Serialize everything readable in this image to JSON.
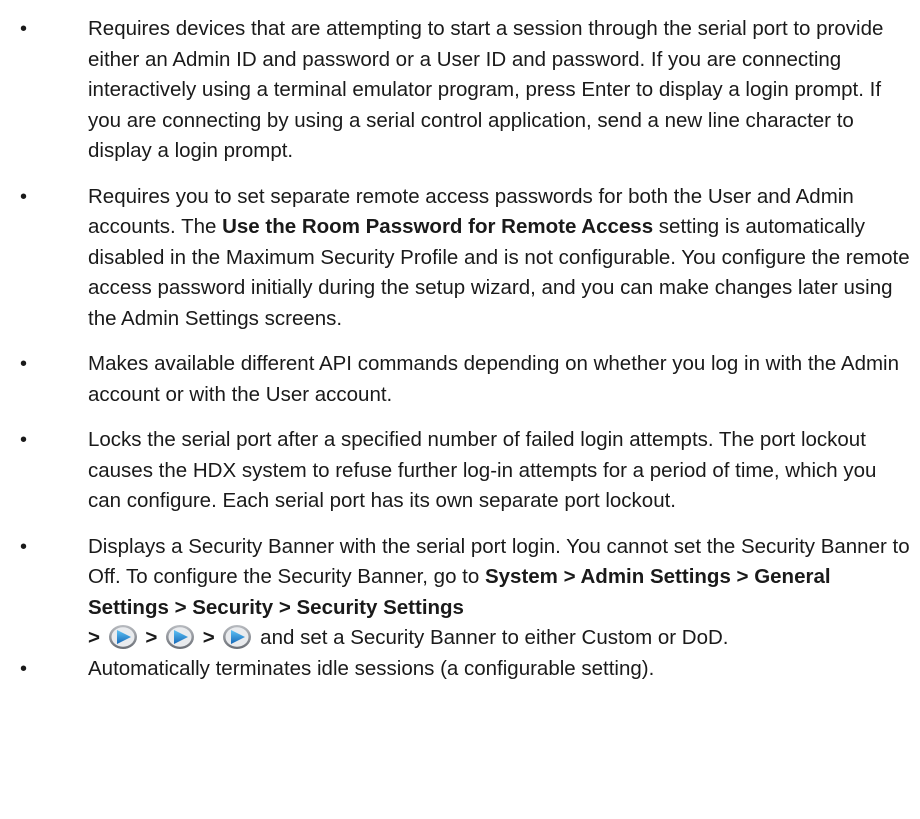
{
  "bullets": [
    {
      "text": "Requires devices that are attempting to start a session through the serial port to provide either an Admin ID and password or a User ID and password. If you are connecting interactively using a terminal emulator program, press Enter to display a login prompt. If you are connecting by using a serial control application, send a new line character to display a login prompt."
    },
    {
      "before": "Requires you to set separate remote access passwords for both the User and Admin accounts. The ",
      "bold": "Use the Room Password for Remote Access",
      "after": " setting is automatically disabled in the Maximum Security Profile and is not configurable. You configure the remote access password initially during the setup wizard, and you can make changes later using the Admin Settings screens."
    },
    {
      "text": "Makes available different API commands depending on whether you log in with the Admin account or with the User account."
    },
    {
      "text": "Locks the serial port after a specified number of failed login attempts. The port lockout causes the HDX system to refuse further log-in attempts for a period of time, which you can configure. Each serial port has its own separate port lockout."
    },
    {
      "before": "Displays a Security Banner with the serial port login. You cannot set the Security Banner to Off. To configure the Security Banner, go to ",
      "bold_path": "System > Admin Settings > General Settings > Security > Security Settings",
      "sep": ">",
      "after": "and set a Security Banner to either Custom or DoD."
    },
    {
      "text": "Automatically terminates idle sessions (a configurable setting)."
    }
  ],
  "bullet_char": "•",
  "icons": {
    "nav_arrow": "next-arrow-icon",
    "arrow_color": "#1d8fd6"
  }
}
